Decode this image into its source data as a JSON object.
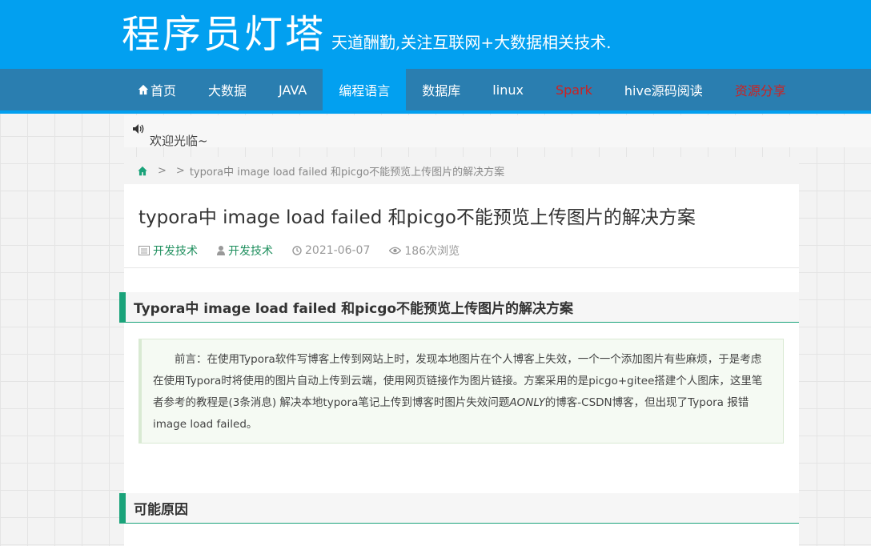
{
  "header": {
    "logo": "程序员灯塔",
    "slogan": "天道酬勤,关注互联网+大数据相关技术."
  },
  "nav": {
    "items": [
      {
        "label": "首页",
        "icon": "home-icon",
        "active": false,
        "color": "#ffffff"
      },
      {
        "label": "大数据",
        "active": false,
        "color": "#ffffff"
      },
      {
        "label": "JAVA",
        "active": false,
        "color": "#ffffff"
      },
      {
        "label": "编程语言",
        "active": true,
        "color": "#ffffff"
      },
      {
        "label": "数据库",
        "active": false,
        "color": "#ffffff"
      },
      {
        "label": "linux",
        "active": false,
        "color": "#ffffff"
      },
      {
        "label": "Spark",
        "active": false,
        "color": "#cc2222"
      },
      {
        "label": "hive源码阅读",
        "active": false,
        "color": "#ffffff"
      },
      {
        "label": "资源分享",
        "active": false,
        "color": "#cc2222"
      }
    ]
  },
  "notice": {
    "icon": "speaker-icon",
    "text": "欢迎光临~"
  },
  "breadcrumb": {
    "icon": "home-icon",
    "sep1": ">",
    "sep2": ">",
    "current": "typora中 image load failed 和picgo不能预览上传图片的解决方案"
  },
  "article": {
    "title": "typora中 image load failed 和picgo不能预览上传图片的解决方案",
    "meta": {
      "category": "开发技术",
      "author": "开发技术",
      "date": "2021-06-07",
      "views": "186次浏览"
    },
    "section1_heading": "Typora中 image load failed 和picgo不能预览上传图片的解决方案",
    "intro": {
      "p1": "前言：在使用Typora软件写博客上传到网站上时，发现本地图片在个人博客上失效，一个一个添加图片有些麻烦，于是考虑在使用Typora时将使用的图片自动上传到云端，使用网页链接作为图片链接。方案采用的是picgo+gitee搭建个人图床，这里笔者参考的教程是(3条消息) 解决本地typora笔记上传到博客时图片失效问题",
      "p1_italic": "AONLY",
      "p1_rest": "的博客-CSDN博客，但出现了Typora 报错image load failed。"
    },
    "section2_heading": "可能原因"
  },
  "colors": {
    "header_bg": "#02a0f0",
    "nav_bg": "#2a7eb0",
    "accent_green": "#1aa37a",
    "link_green": "#1f8f5e",
    "nav_red": "#cc2222"
  }
}
